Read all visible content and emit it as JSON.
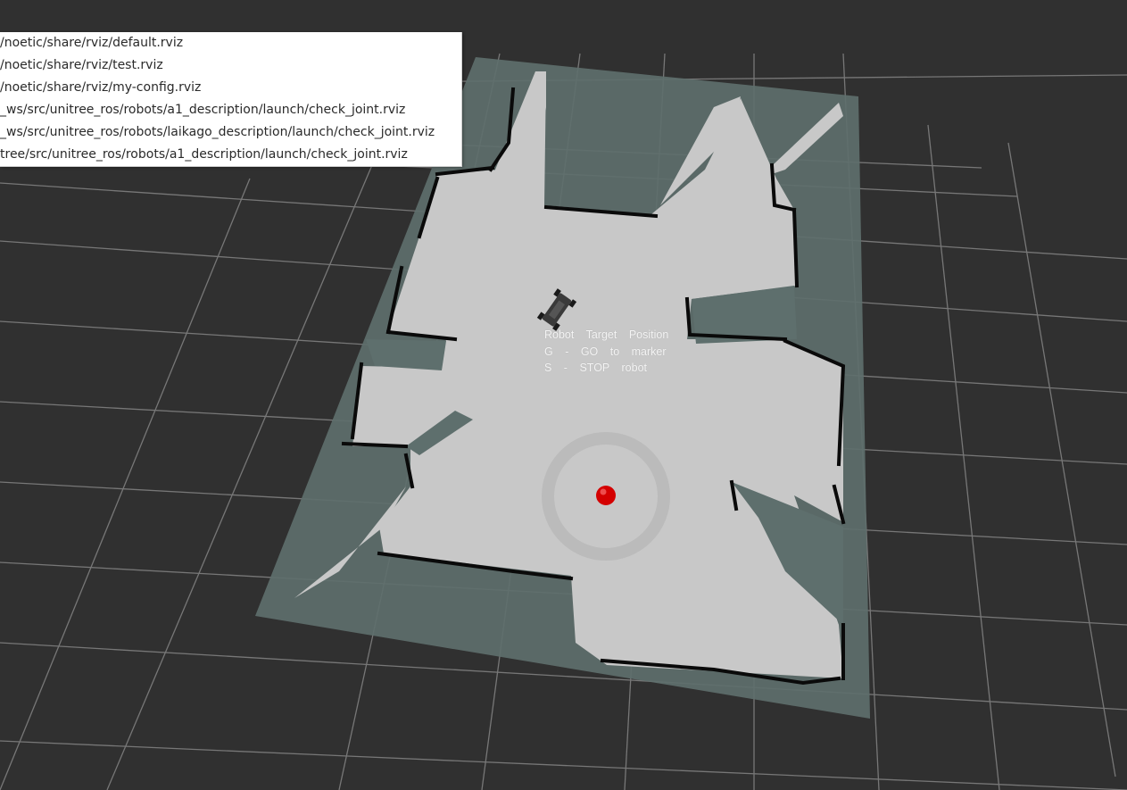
{
  "recent_configs": [
    "/noetic/share/rviz/default.rviz",
    "/noetic/share/rviz/test.rviz",
    "/noetic/share/rviz/my-config.rviz",
    "_ws/src/unitree_ros/robots/a1_description/launch/check_joint.rviz",
    "_ws/src/unitree_ros/robots/laikago_description/launch/check_joint.rviz",
    "tree/src/unitree_ros/robots/a1_description/launch/check_joint.rviz"
  ],
  "hud": {
    "line1": "Robot Target Position",
    "line2": "G - GO to marker",
    "line3": "S - STOP robot"
  },
  "colors": {
    "background": "#303030",
    "grid": "#a0a0a0",
    "map_unknown": "#5e6f6d",
    "map_free": "#c8c8c8",
    "map_wall": "#0a0a0a",
    "marker": "#d40000"
  },
  "icons": {
    "robot": "robot-icon",
    "target": "target-marker-icon"
  }
}
